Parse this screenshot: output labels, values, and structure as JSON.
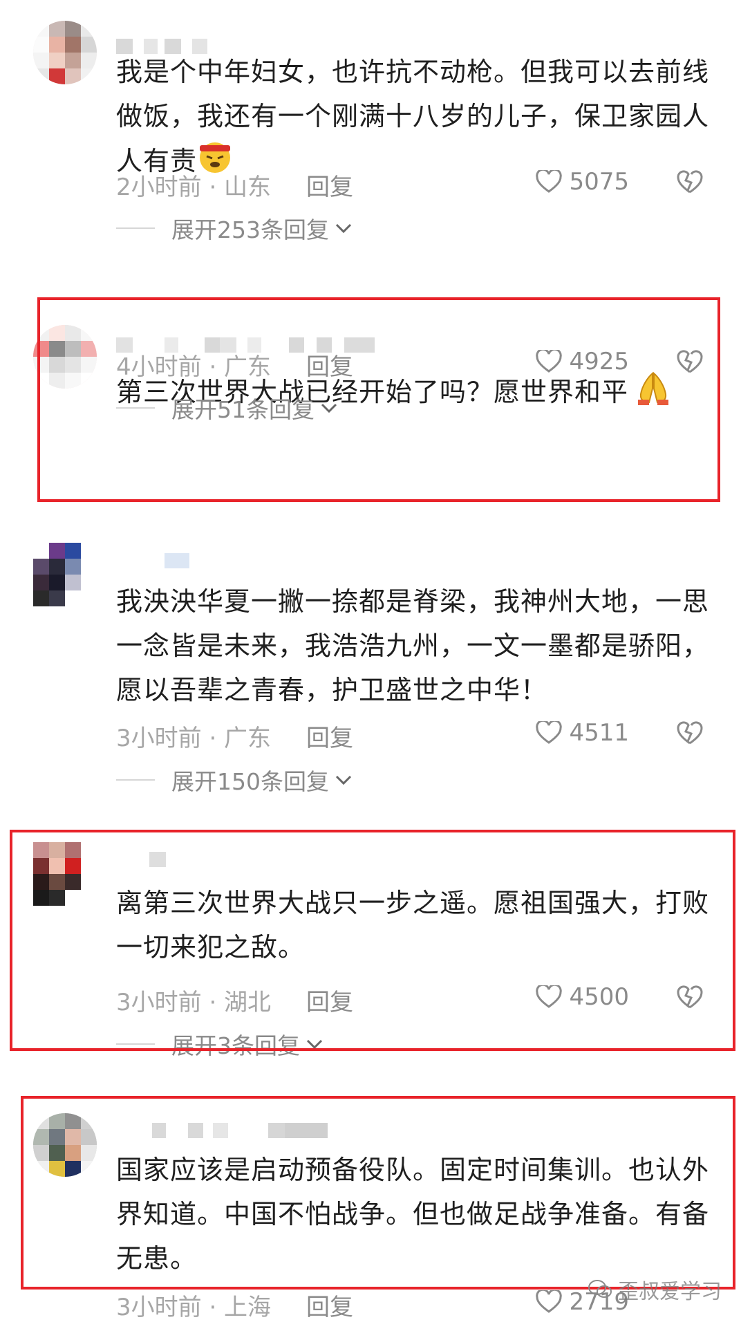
{
  "comments": [
    {
      "text": "我是个中年妇女，也许抗不动枪。但我可以去前线做饭，我还有一个刚满十八岁的儿子，保卫家园人人有责",
      "emoji": "angry-face-headband-emoji",
      "time": "2小时前 · 山东",
      "reply": "回复",
      "likes": "5075",
      "expand": "展开253条回复"
    },
    {
      "text": "第三次世界大战已经开始了吗？愿世界和平",
      "emoji": "folded-hands-emoji",
      "time": "4小时前 · 广东",
      "reply": "回复",
      "likes": "4925",
      "expand": "展开51条回复"
    },
    {
      "text": "我泱泱华夏一撇一捺都是脊梁，我神州大地，一思一念皆是未来，我浩浩九州，一文一墨都是骄阳，愿以吾辈之青春，护卫盛世之中华！",
      "time": "3小时前 · 广东",
      "reply": "回复",
      "likes": "4511",
      "expand": "展开150条回复"
    },
    {
      "text": "离第三次世界大战只一步之遥。愿祖国强大，打败一切来犯之敌。",
      "time": "3小时前 · 湖北",
      "reply": "回复",
      "likes": "4500",
      "expand": "展开3条回复"
    },
    {
      "text": "国家应该是启动预备役队。固定时间集训。也认外界知道。中国不怕战争。但也做足战争准备。有备无患。",
      "time": "3小时前 · 上海",
      "reply": "回复",
      "likes": "2719"
    }
  ],
  "watermark": "歪叔爱学习",
  "colors": {
    "highlight_border": "#e8232a",
    "meta_gray": "#a6a6a6"
  }
}
